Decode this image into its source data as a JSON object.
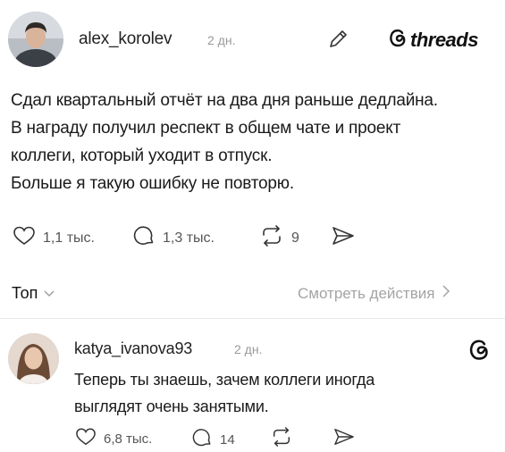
{
  "post": {
    "username": "alex_korolev",
    "time": "2 дн.",
    "lines": [
      "Сдал квартальный отчёт на два дня раньше дедлайна.",
      "В награду получил респект в общем чате и проект",
      "коллеги, который уходит в отпуск.",
      "Больше я такую ошибку не повторю."
    ],
    "likes": "1,1 тыс.",
    "replies": "1,3 тыс.",
    "reposts": "9"
  },
  "header": {
    "brand": "threads"
  },
  "sort": {
    "label": "Топ"
  },
  "view_activity": {
    "label": "Смотреть действия"
  },
  "reply": {
    "username": "katya_ivanova93",
    "time": "2 дн.",
    "lines": [
      "Теперь ты знаешь, зачем коллеги иногда",
      "выглядят очень занятыми."
    ],
    "likes": "6,8 тыс.",
    "replies": "14"
  },
  "icons": {
    "edit": "pencil-icon",
    "brand": "threads-logo-icon",
    "like": "heart-icon",
    "reply": "comment-icon",
    "repost": "repost-icon",
    "share": "send-icon",
    "chevron_down": "chevron-down-icon",
    "chevron_right": "chevron-right-icon"
  }
}
